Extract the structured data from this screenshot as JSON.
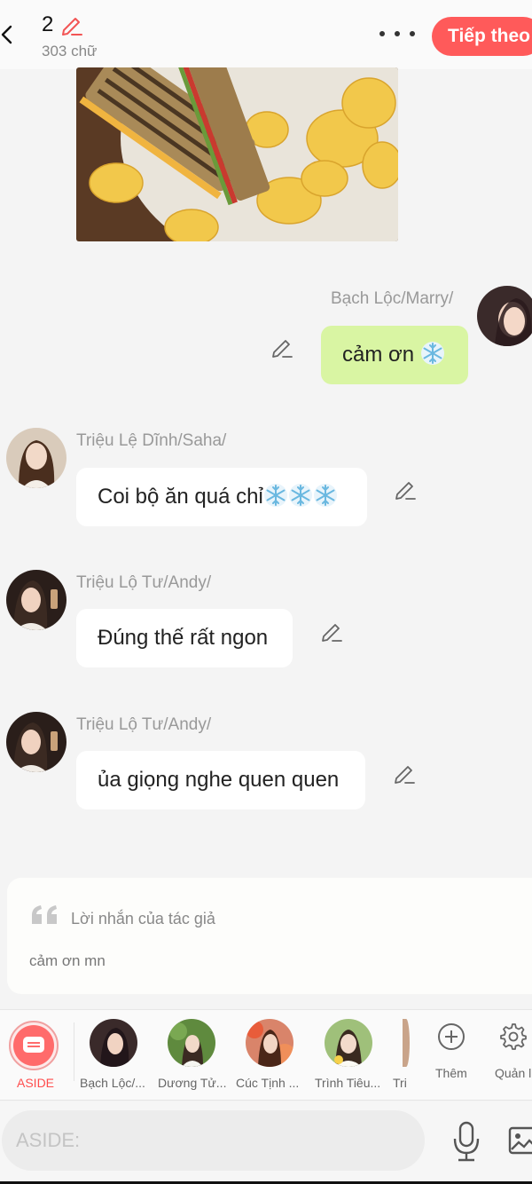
{
  "header": {
    "chapter_number": "2",
    "word_count": "303 chữ",
    "next_label": "Tiếp theo"
  },
  "messages": [
    {
      "name": "Bạch Lộc/Marry/",
      "text": "cảm ơn ",
      "emoji": [
        "snowflake-icon"
      ],
      "side": "right"
    },
    {
      "name": "Triệu Lệ Dĩnh/Saha/",
      "text": "Coi bộ ăn quá chỉ",
      "emoji": [
        "snowflake-icon",
        "snowflake-icon",
        "snowflake-icon"
      ],
      "side": "left"
    },
    {
      "name": "Triệu Lộ Tư/Andy/",
      "text": "Đúng thế rất ngon",
      "side": "left"
    },
    {
      "name": "Triệu Lộ Tư/Andy/",
      "text": "ủa giọng nghe quen quen",
      "side": "left"
    }
  ],
  "author_note": {
    "title": "Lời nhắn của tác giả",
    "body": "cảm ơn mn"
  },
  "character_bar": {
    "aside_label": "ASIDE",
    "characters": [
      "Bạch Lộc/...",
      "Dương Tử...",
      "Cúc Tịnh ...",
      "Trình Tiêu...",
      "Tri"
    ],
    "add_label": "Thêm",
    "manage_label": "Quản l"
  },
  "input": {
    "placeholder": "ASIDE:"
  },
  "colors": {
    "accent": "#ff5a5a",
    "my_bubble": "#d9f5a3",
    "other_bubble": "#ffffff",
    "background": "#f4f4f4"
  }
}
